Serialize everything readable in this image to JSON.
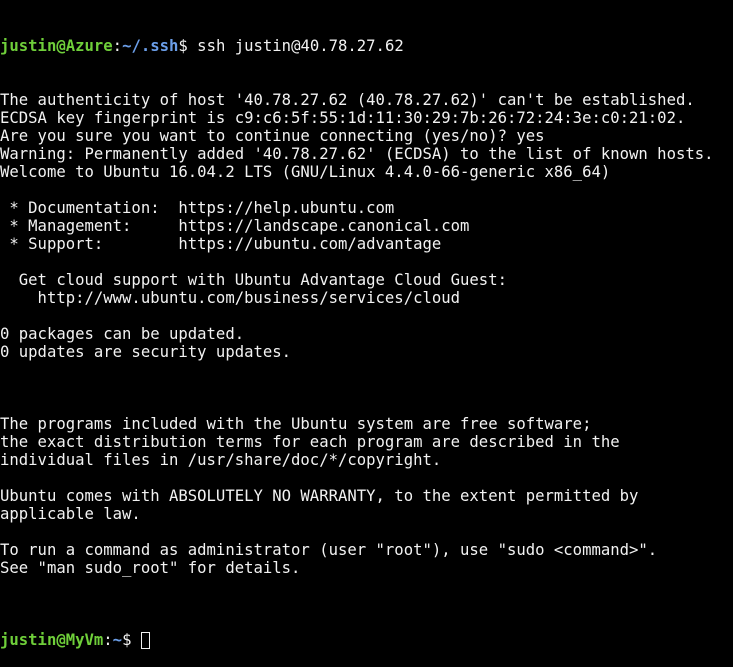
{
  "prompt1": {
    "user_host": "justin@Azure",
    "sep": ":",
    "path": "~/.ssh",
    "symbol": "$",
    "command": " ssh justin@40.78.27.62"
  },
  "output": [
    "The authenticity of host '40.78.27.62 (40.78.27.62)' can't be established.",
    "ECDSA key fingerprint is c9:c6:5f:55:1d:11:30:29:7b:26:72:24:3e:c0:21:02.",
    "Are you sure you want to continue connecting (yes/no)? yes",
    "Warning: Permanently added '40.78.27.62' (ECDSA) to the list of known hosts.",
    "Welcome to Ubuntu 16.04.2 LTS (GNU/Linux 4.4.0-66-generic x86_64)",
    "",
    " * Documentation:  https://help.ubuntu.com",
    " * Management:     https://landscape.canonical.com",
    " * Support:        https://ubuntu.com/advantage",
    "",
    "  Get cloud support with Ubuntu Advantage Cloud Guest:",
    "    http://www.ubuntu.com/business/services/cloud",
    "",
    "0 packages can be updated.",
    "0 updates are security updates.",
    "",
    "",
    "",
    "The programs included with the Ubuntu system are free software;",
    "the exact distribution terms for each program are described in the",
    "individual files in /usr/share/doc/*/copyright.",
    "",
    "Ubuntu comes with ABSOLUTELY NO WARRANTY, to the extent permitted by",
    "applicable law.",
    "",
    "To run a command as administrator (user \"root\"), use \"sudo <command>\".",
    "See \"man sudo_root\" for details.",
    ""
  ],
  "prompt2": {
    "user_host": "justin@MyVm",
    "sep": ":",
    "path": "~",
    "symbol": "$",
    "command": " "
  },
  "colors": {
    "user": "#6fcf3a",
    "path": "#6b9ee8",
    "text": "#f2f2f2",
    "background": "#000000"
  }
}
